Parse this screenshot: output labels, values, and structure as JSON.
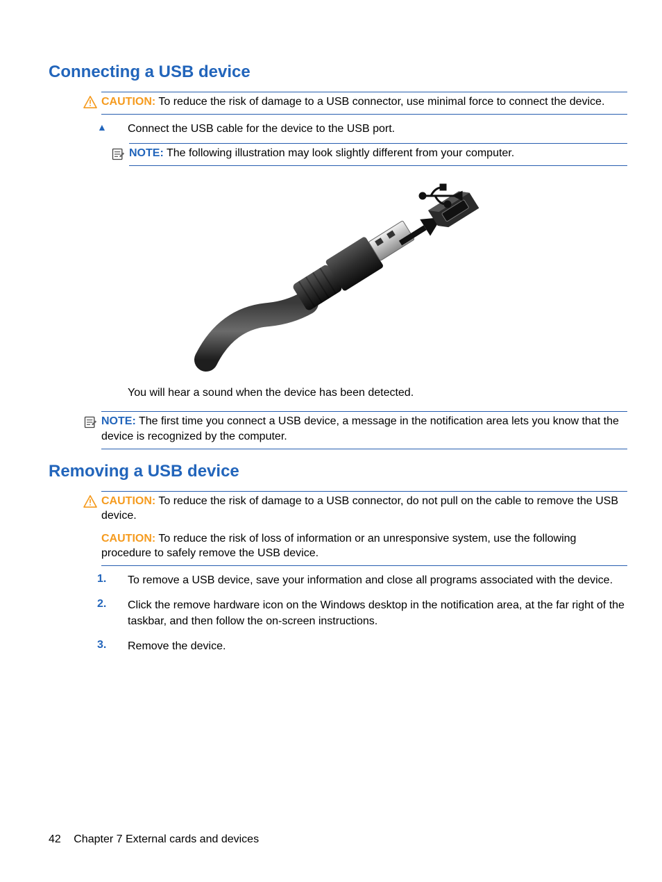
{
  "section1": {
    "heading": "Connecting a USB device",
    "caution": {
      "label": "CAUTION:",
      "text": "To reduce the risk of damage to a USB connector, use minimal force to connect the device."
    },
    "step": "Connect the USB cable for the device to the USB port.",
    "note1": {
      "label": "NOTE:",
      "text": "The following illustration may look slightly different from your computer."
    },
    "afterImg": "You will hear a sound when the device has been detected.",
    "note2": {
      "label": "NOTE:",
      "text": "The first time you connect a USB device, a message in the notification area lets you know that the device is recognized by the computer."
    }
  },
  "section2": {
    "heading": "Removing a USB device",
    "caution1": {
      "label": "CAUTION:",
      "text": "To reduce the risk of damage to a USB connector, do not pull on the cable to remove the USB device."
    },
    "caution2": {
      "label": "CAUTION:",
      "text": "To reduce the risk of loss of information or an unresponsive system, use the following procedure to safely remove the USB device."
    },
    "steps": [
      {
        "n": "1.",
        "text": "To remove a USB device, save your information and close all programs associated with the device."
      },
      {
        "n": "2.",
        "text": "Click the remove hardware icon on the Windows desktop in the notification area, at the far right of the taskbar, and then follow the on-screen instructions."
      },
      {
        "n": "3.",
        "text": "Remove the device."
      }
    ]
  },
  "footer": {
    "page": "42",
    "chapter": "Chapter 7   External cards and devices"
  }
}
